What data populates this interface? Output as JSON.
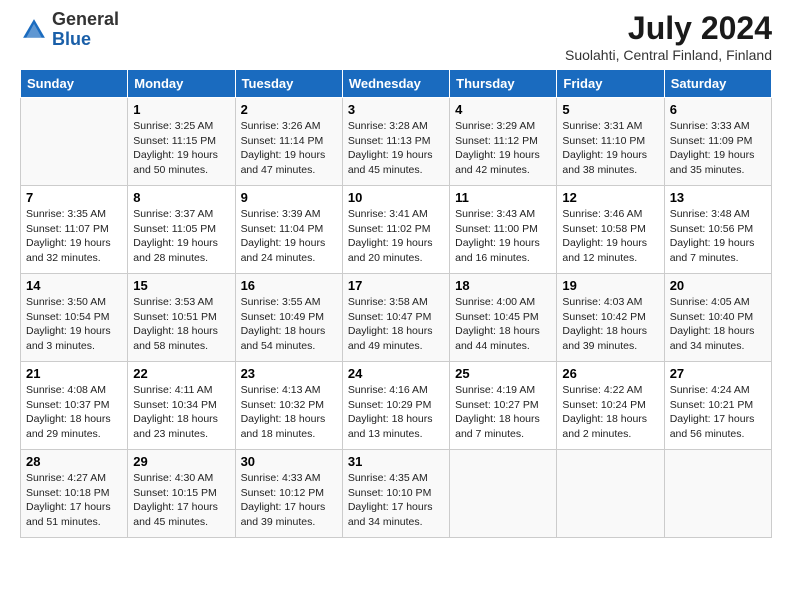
{
  "header": {
    "logo_general": "General",
    "logo_blue": "Blue",
    "month_year": "July 2024",
    "location": "Suolahti, Central Finland, Finland"
  },
  "days_of_week": [
    "Sunday",
    "Monday",
    "Tuesday",
    "Wednesday",
    "Thursday",
    "Friday",
    "Saturday"
  ],
  "weeks": [
    [
      {
        "day": "",
        "sunrise": "",
        "sunset": "",
        "daylight": ""
      },
      {
        "day": "1",
        "sunrise": "Sunrise: 3:25 AM",
        "sunset": "Sunset: 11:15 PM",
        "daylight": "Daylight: 19 hours and 50 minutes."
      },
      {
        "day": "2",
        "sunrise": "Sunrise: 3:26 AM",
        "sunset": "Sunset: 11:14 PM",
        "daylight": "Daylight: 19 hours and 47 minutes."
      },
      {
        "day": "3",
        "sunrise": "Sunrise: 3:28 AM",
        "sunset": "Sunset: 11:13 PM",
        "daylight": "Daylight: 19 hours and 45 minutes."
      },
      {
        "day": "4",
        "sunrise": "Sunrise: 3:29 AM",
        "sunset": "Sunset: 11:12 PM",
        "daylight": "Daylight: 19 hours and 42 minutes."
      },
      {
        "day": "5",
        "sunrise": "Sunrise: 3:31 AM",
        "sunset": "Sunset: 11:10 PM",
        "daylight": "Daylight: 19 hours and 38 minutes."
      },
      {
        "day": "6",
        "sunrise": "Sunrise: 3:33 AM",
        "sunset": "Sunset: 11:09 PM",
        "daylight": "Daylight: 19 hours and 35 minutes."
      }
    ],
    [
      {
        "day": "7",
        "sunrise": "Sunrise: 3:35 AM",
        "sunset": "Sunset: 11:07 PM",
        "daylight": "Daylight: 19 hours and 32 minutes."
      },
      {
        "day": "8",
        "sunrise": "Sunrise: 3:37 AM",
        "sunset": "Sunset: 11:05 PM",
        "daylight": "Daylight: 19 hours and 28 minutes."
      },
      {
        "day": "9",
        "sunrise": "Sunrise: 3:39 AM",
        "sunset": "Sunset: 11:04 PM",
        "daylight": "Daylight: 19 hours and 24 minutes."
      },
      {
        "day": "10",
        "sunrise": "Sunrise: 3:41 AM",
        "sunset": "Sunset: 11:02 PM",
        "daylight": "Daylight: 19 hours and 20 minutes."
      },
      {
        "day": "11",
        "sunrise": "Sunrise: 3:43 AM",
        "sunset": "Sunset: 11:00 PM",
        "daylight": "Daylight: 19 hours and 16 minutes."
      },
      {
        "day": "12",
        "sunrise": "Sunrise: 3:46 AM",
        "sunset": "Sunset: 10:58 PM",
        "daylight": "Daylight: 19 hours and 12 minutes."
      },
      {
        "day": "13",
        "sunrise": "Sunrise: 3:48 AM",
        "sunset": "Sunset: 10:56 PM",
        "daylight": "Daylight: 19 hours and 7 minutes."
      }
    ],
    [
      {
        "day": "14",
        "sunrise": "Sunrise: 3:50 AM",
        "sunset": "Sunset: 10:54 PM",
        "daylight": "Daylight: 19 hours and 3 minutes."
      },
      {
        "day": "15",
        "sunrise": "Sunrise: 3:53 AM",
        "sunset": "Sunset: 10:51 PM",
        "daylight": "Daylight: 18 hours and 58 minutes."
      },
      {
        "day": "16",
        "sunrise": "Sunrise: 3:55 AM",
        "sunset": "Sunset: 10:49 PM",
        "daylight": "Daylight: 18 hours and 54 minutes."
      },
      {
        "day": "17",
        "sunrise": "Sunrise: 3:58 AM",
        "sunset": "Sunset: 10:47 PM",
        "daylight": "Daylight: 18 hours and 49 minutes."
      },
      {
        "day": "18",
        "sunrise": "Sunrise: 4:00 AM",
        "sunset": "Sunset: 10:45 PM",
        "daylight": "Daylight: 18 hours and 44 minutes."
      },
      {
        "day": "19",
        "sunrise": "Sunrise: 4:03 AM",
        "sunset": "Sunset: 10:42 PM",
        "daylight": "Daylight: 18 hours and 39 minutes."
      },
      {
        "day": "20",
        "sunrise": "Sunrise: 4:05 AM",
        "sunset": "Sunset: 10:40 PM",
        "daylight": "Daylight: 18 hours and 34 minutes."
      }
    ],
    [
      {
        "day": "21",
        "sunrise": "Sunrise: 4:08 AM",
        "sunset": "Sunset: 10:37 PM",
        "daylight": "Daylight: 18 hours and 29 minutes."
      },
      {
        "day": "22",
        "sunrise": "Sunrise: 4:11 AM",
        "sunset": "Sunset: 10:34 PM",
        "daylight": "Daylight: 18 hours and 23 minutes."
      },
      {
        "day": "23",
        "sunrise": "Sunrise: 4:13 AM",
        "sunset": "Sunset: 10:32 PM",
        "daylight": "Daylight: 18 hours and 18 minutes."
      },
      {
        "day": "24",
        "sunrise": "Sunrise: 4:16 AM",
        "sunset": "Sunset: 10:29 PM",
        "daylight": "Daylight: 18 hours and 13 minutes."
      },
      {
        "day": "25",
        "sunrise": "Sunrise: 4:19 AM",
        "sunset": "Sunset: 10:27 PM",
        "daylight": "Daylight: 18 hours and 7 minutes."
      },
      {
        "day": "26",
        "sunrise": "Sunrise: 4:22 AM",
        "sunset": "Sunset: 10:24 PM",
        "daylight": "Daylight: 18 hours and 2 minutes."
      },
      {
        "day": "27",
        "sunrise": "Sunrise: 4:24 AM",
        "sunset": "Sunset: 10:21 PM",
        "daylight": "Daylight: 17 hours and 56 minutes."
      }
    ],
    [
      {
        "day": "28",
        "sunrise": "Sunrise: 4:27 AM",
        "sunset": "Sunset: 10:18 PM",
        "daylight": "Daylight: 17 hours and 51 minutes."
      },
      {
        "day": "29",
        "sunrise": "Sunrise: 4:30 AM",
        "sunset": "Sunset: 10:15 PM",
        "daylight": "Daylight: 17 hours and 45 minutes."
      },
      {
        "day": "30",
        "sunrise": "Sunrise: 4:33 AM",
        "sunset": "Sunset: 10:12 PM",
        "daylight": "Daylight: 17 hours and 39 minutes."
      },
      {
        "day": "31",
        "sunrise": "Sunrise: 4:35 AM",
        "sunset": "Sunset: 10:10 PM",
        "daylight": "Daylight: 17 hours and 34 minutes."
      },
      {
        "day": "",
        "sunrise": "",
        "sunset": "",
        "daylight": ""
      },
      {
        "day": "",
        "sunrise": "",
        "sunset": "",
        "daylight": ""
      },
      {
        "day": "",
        "sunrise": "",
        "sunset": "",
        "daylight": ""
      }
    ]
  ]
}
